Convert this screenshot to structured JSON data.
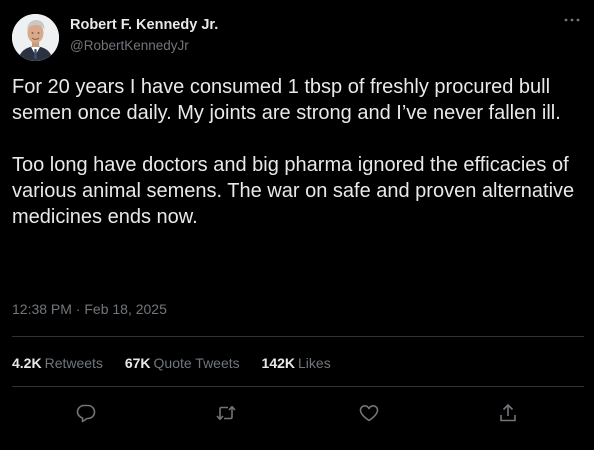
{
  "author": {
    "display_name": "Robert F. Kennedy Jr.",
    "handle": "@RobertKennedyJr",
    "avatar_icon": "profile-photo"
  },
  "tweet": {
    "paragraphs": [
      "For 20 years I have consumed 1 tbsp of freshly procured bull semen once daily. My joints are strong and I’ve never fallen ill.",
      "Too long have doctors and big pharma ignored the efficacies of various animal semens. The war on safe and proven alternative medicines ends now."
    ],
    "timestamp": "12:38 PM · Feb 18, 2025"
  },
  "stats": {
    "retweets": {
      "count": "4.2K",
      "label": "Retweets"
    },
    "quote_tweets": {
      "count": "67K",
      "label": "Quote Tweets"
    },
    "likes": {
      "count": "142K",
      "label": "Likes"
    }
  },
  "actions": [
    "reply-icon",
    "retweet-icon",
    "like-icon",
    "share-icon"
  ],
  "colors": {
    "background": "#000000",
    "primary_text": "#e7e9ea",
    "secondary_text": "#71767b",
    "divider": "#2f3336"
  }
}
